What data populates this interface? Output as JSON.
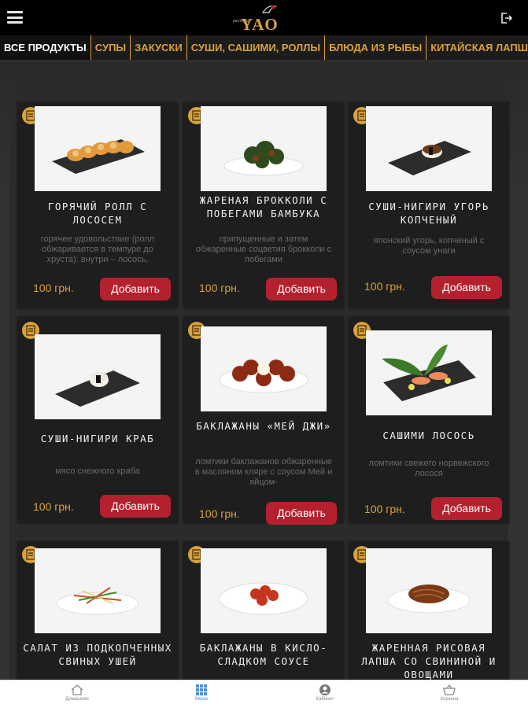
{
  "header": {
    "logo_text": "YAO",
    "logo_small": "рестобар"
  },
  "tabs": [
    "ВСЕ ПРОДУКТЫ",
    "СУПЫ",
    "ЗАКУСКИ",
    "СУШИ, САШИМИ, РОЛЛЫ",
    "БЛЮДА ИЗ РЫБЫ",
    "КИТАЙСКАЯ ЛАПША"
  ],
  "products": [
    {
      "title": "Горячий ролл с лососем",
      "desc": "горячее удовольствие (ролл обжаривается в темпуре до хруста): внутри – лосось,",
      "price": "100 грн.",
      "button": "Добавить"
    },
    {
      "title": "Жареная брокколи с побегами бамбука",
      "desc": "припущенные и затем обжаренные соцветия брокколи с побегами",
      "price": "100 грн.",
      "button": "Добавить"
    },
    {
      "title": "Суши-нигири угорь копченый",
      "desc": "японский угорь, копченый с соусом унаги",
      "price": "100 грн.",
      "button": "Добавить"
    },
    {
      "title": "Суши-нигири краб",
      "desc": "мясо снежного краба",
      "price": "100 грн.",
      "button": "Добавить"
    },
    {
      "title": "Баклажаны «Мей Джи»",
      "desc": "ломтики баклажанов обжаренные в масляном кляре с соусом Мей и яйцом-",
      "price": "100 грн.",
      "button": "Добавить"
    },
    {
      "title": "Сашими лосось",
      "desc": "ломтики свежего норвежского лосося",
      "price": "100 грн.",
      "button": "Добавить"
    },
    {
      "title": "Салат из подкопченных свиных ушей",
      "desc": "",
      "price": "",
      "button": ""
    },
    {
      "title": "Баклажаны в кисло-сладком соусе",
      "desc": "",
      "price": "",
      "button": ""
    },
    {
      "title": "Жаренная рисовая лапша со свининой и овощами",
      "desc": "",
      "price": "",
      "button": ""
    }
  ],
  "bottom_nav": [
    {
      "label": "Домашняя",
      "icon": "home-icon"
    },
    {
      "label": "Меню",
      "icon": "menu-grid-icon"
    },
    {
      "label": "Кабинет",
      "icon": "user-icon"
    },
    {
      "label": "Корзина",
      "icon": "basket-icon"
    }
  ],
  "colors": {
    "accent": "#d9a13b",
    "button": "#b5202e",
    "header": "#000000",
    "card": "#1e1e1e"
  }
}
